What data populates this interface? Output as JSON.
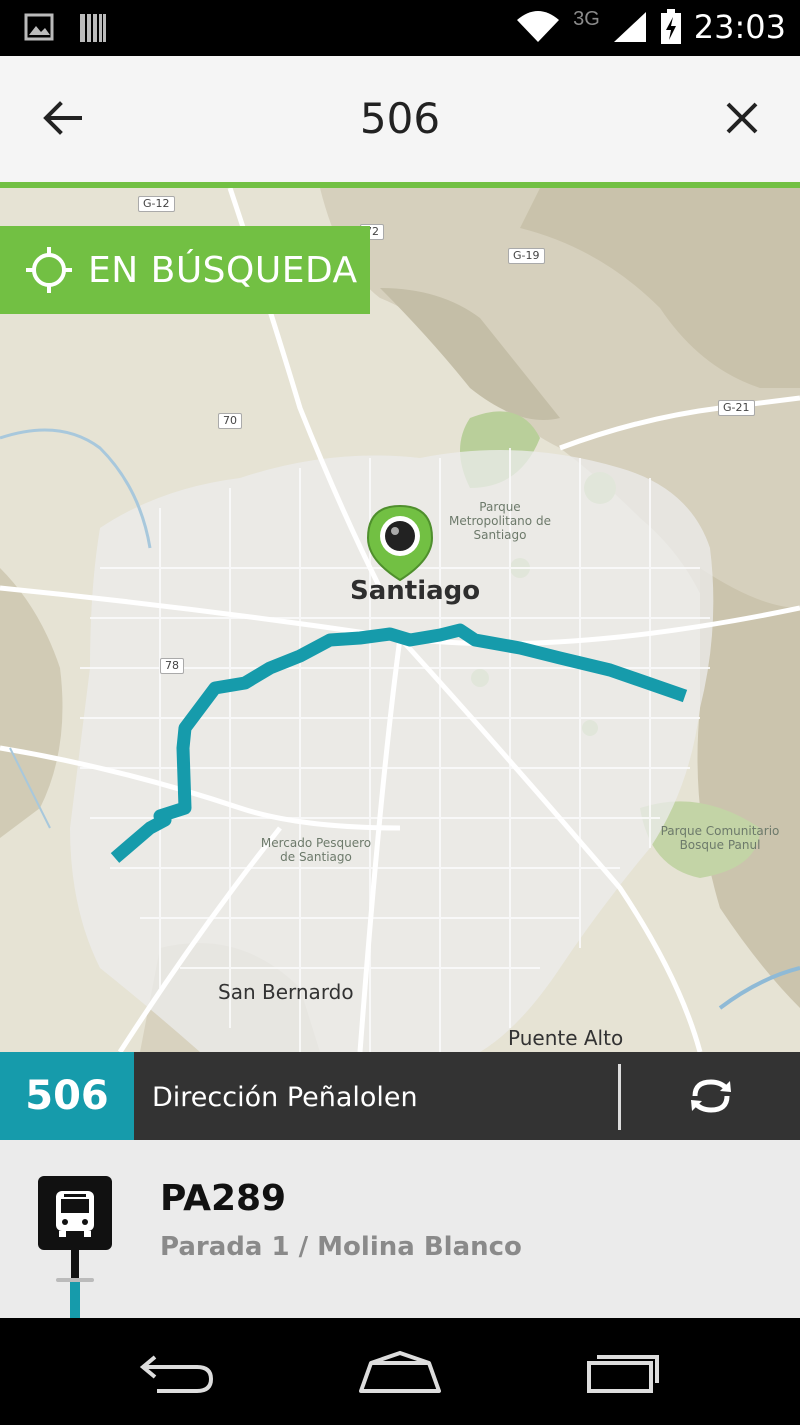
{
  "status_bar": {
    "time": "23:03",
    "network": "3G",
    "icons": [
      "image-notification-icon",
      "barcode-notification-icon",
      "wifi-icon",
      "signal-icon",
      "battery-charging-icon"
    ]
  },
  "header": {
    "title": "506",
    "back_icon": "arrow-left-icon",
    "close_icon": "close-icon"
  },
  "map": {
    "search_badge": {
      "label": "EN BÚSQUEDA",
      "icon": "crosshair-icon"
    },
    "city_label": "Santiago",
    "town_labels": [
      "San Bernardo",
      "Puente Alto"
    ],
    "poi_labels": [
      "Parque Metropolitano de Santiago",
      "Mercado Pesquero de Santiago",
      "Parque Comunitario Bosque Panul"
    ],
    "road_shields": [
      "G-12",
      "G-19",
      "G-21",
      "70",
      "78",
      "72"
    ],
    "route_color": "#169bab",
    "accent_color": "#72c043"
  },
  "route_bar": {
    "route_number": "506",
    "direction": "Dirección Peñalolen",
    "refresh_icon": "refresh-icon"
  },
  "stop": {
    "code": "PA289",
    "name": "Parada 1 / Molina Blanco",
    "icon": "bus-stop-icon"
  },
  "nav_bar": {
    "buttons": [
      "back-nav-icon",
      "home-nav-icon",
      "recents-nav-icon"
    ]
  }
}
